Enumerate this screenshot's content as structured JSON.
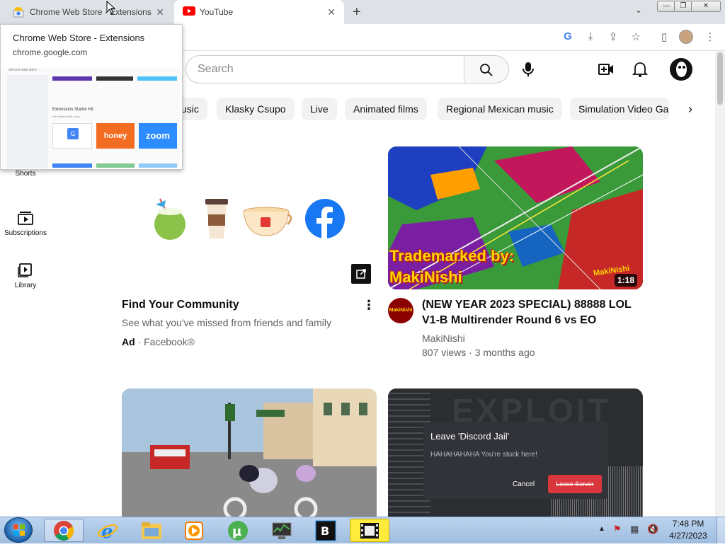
{
  "browser": {
    "tabs": [
      {
        "title": "Chrome Web Store - Extensions"
      },
      {
        "title": "YouTube"
      }
    ]
  },
  "tab_hover": {
    "title": "Chrome Web Store - Extensions",
    "url": "chrome.google.com",
    "thumb_header": "chrome web store",
    "thumb_section": "Extensions Starter Kit",
    "thumb_subtitle": "Get started with a few...",
    "thumb_honey": "honey",
    "thumb_zoom": "zoom"
  },
  "youtube": {
    "search_placeholder": "Search",
    "chips": [
      "usic",
      "Klasky Csupo",
      "Live",
      "Animated films",
      "Regional Mexican music",
      "Simulation Video Ga"
    ],
    "sidebar": [
      {
        "label": "Shorts"
      },
      {
        "label": "Subscriptions"
      },
      {
        "label": "Library"
      }
    ],
    "ad": {
      "title": "Find Your Community",
      "description": "See what you've missed from friends and family",
      "ad_label": "Ad",
      "advertiser": "· Facebook®"
    },
    "video1": {
      "title_line1": "(NEW YEAR 2023 SPECIAL) 88888 LOL",
      "title_line2": "V1-B Multirender Round 6 vs EO",
      "channel": "MakiNishi",
      "stats": "807 views · 3 months ago",
      "duration": "1:18",
      "thumb_text1": "Trademarked by:",
      "thumb_text2": "MakiNishi",
      "thumb_watermark": "MakiNishi",
      "channel_avatar_text": "MakiNishi"
    },
    "video3": {
      "bg_text": "EXPLOIT",
      "dialog_title": "Leave 'Discord Jail'",
      "dialog_body": "HAHAHAHAHA You're stuck here!",
      "cancel": "Cancel",
      "leave": "Leave Server"
    }
  },
  "taskbar": {
    "time": "7:48 PM",
    "date": "4/27/2023"
  },
  "colors": {
    "youtube_red": "#ff0000",
    "facebook_blue": "#1877f2",
    "discord_red": "#da373c",
    "taskbar": "#a9c6e8"
  }
}
